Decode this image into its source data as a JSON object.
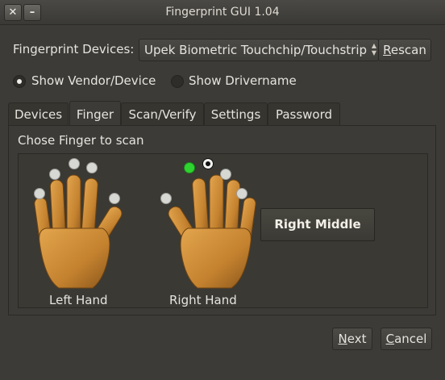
{
  "window": {
    "title": "Fingerprint GUI 1.04",
    "close_glyph": "✕",
    "minimize_glyph": "–"
  },
  "devices": {
    "label": "Fingerprint Devices:",
    "selected": "Upek Biometric Touchchip/Touchstrip",
    "rescan_prefix": "",
    "rescan_underlined": "R",
    "rescan_rest": "escan"
  },
  "display_mode": {
    "options": [
      {
        "label": "Show Vendor/Device",
        "checked": true
      },
      {
        "label": "Show Drivername",
        "checked": false
      }
    ]
  },
  "tabs": [
    {
      "label": "Devices",
      "active": false
    },
    {
      "label": "Finger",
      "active": true
    },
    {
      "label": "Scan/Verify",
      "active": false
    },
    {
      "label": "Settings",
      "active": false
    },
    {
      "label": "Password",
      "active": false
    }
  ],
  "finger_tab": {
    "heading": "Chose Finger to scan",
    "left_hand_label": "Left Hand",
    "right_hand_label": "Right Hand",
    "selected_finger": "Right Middle",
    "enrolled_fingers": [
      "Right Index"
    ],
    "current_finger": "Right Middle"
  },
  "footer": {
    "next_underlined": "N",
    "next_rest": "ext",
    "cancel_underlined": "C",
    "cancel_rest": "ancel"
  },
  "colors": {
    "background": "#3c3b37",
    "enrolled": "#2fd32f",
    "skin": "#c98a3a"
  }
}
